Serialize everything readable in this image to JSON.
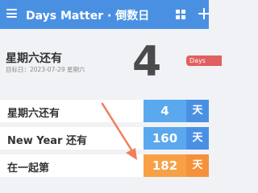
{
  "appbar": {
    "title": "Days Matter · 倒数日",
    "icons": [
      "menu-icon",
      "grid-icon",
      "plus-icon"
    ]
  },
  "hero": {
    "title": "星期六还有",
    "subtitle": "目标日：2023-07-29 星期六",
    "number": "4",
    "badge": "Days"
  },
  "rows": [
    {
      "label": "星期六还有",
      "count": "4",
      "unit": "天",
      "color": "#5aa8ee",
      "unit_color": "#4a90e2"
    },
    {
      "label": "New Year 还有",
      "count": "160",
      "unit": "天",
      "color": "#5aa8ee",
      "unit_color": "#4a90e2"
    },
    {
      "label": "在一起第",
      "count": "182",
      "unit": "天",
      "color": "#f8a046",
      "unit_color": "#f5913a"
    }
  ],
  "colors": {
    "appbar": "#4a90e2",
    "badge": "#e0605f",
    "annotation_arrow": "#f07f5a"
  }
}
